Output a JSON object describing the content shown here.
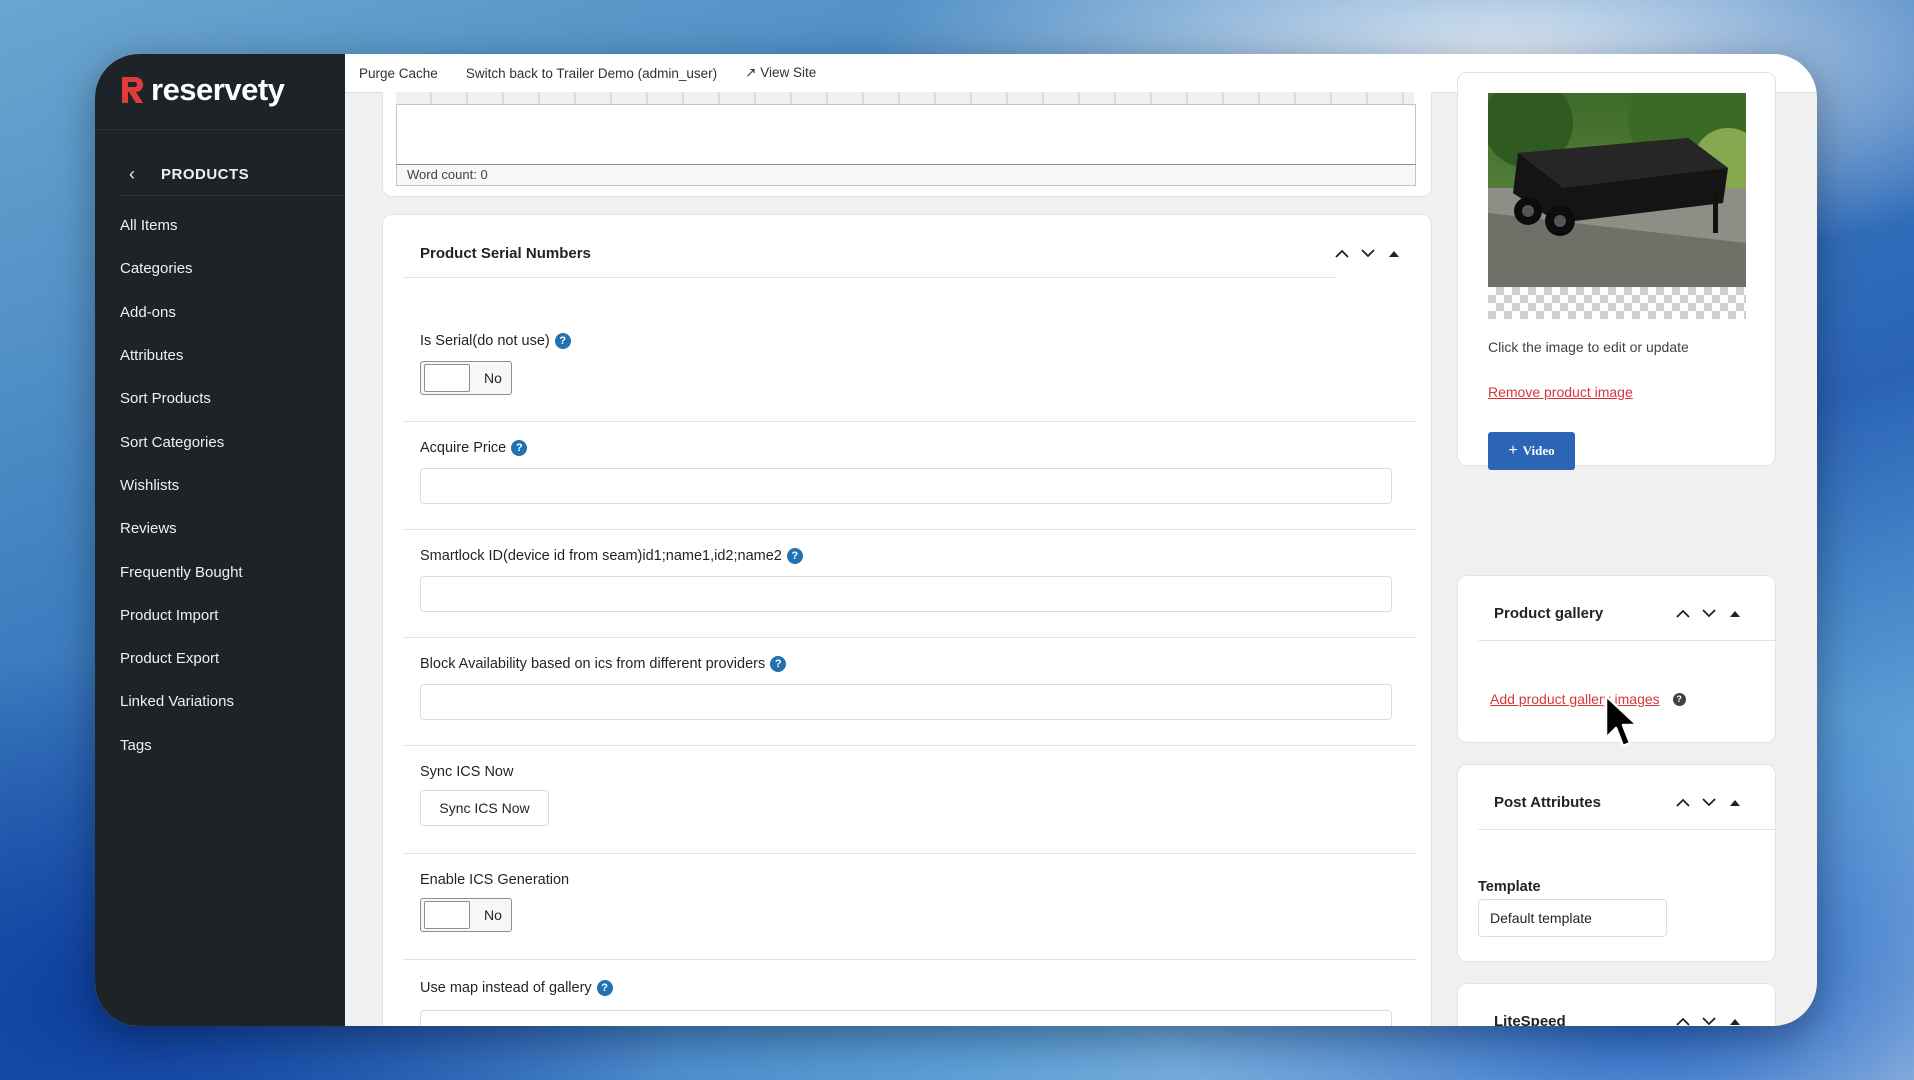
{
  "brand": {
    "name": "reservety",
    "accent": "#e03a3a"
  },
  "sidebar": {
    "section_title": "PRODUCTS",
    "items": [
      {
        "label": "All Items"
      },
      {
        "label": "Categories"
      },
      {
        "label": "Add-ons"
      },
      {
        "label": "Attributes"
      },
      {
        "label": "Sort Products"
      },
      {
        "label": "Sort Categories"
      },
      {
        "label": "Wishlists"
      },
      {
        "label": "Reviews"
      },
      {
        "label": "Frequently Bought"
      },
      {
        "label": "Product Import"
      },
      {
        "label": "Product Export"
      },
      {
        "label": "Linked Variations"
      },
      {
        "label": "Tags"
      }
    ]
  },
  "topbar": {
    "purge_cache": "Purge Cache",
    "switch_back": "Switch back to Trailer Demo (admin_user)",
    "view_site": "↗ View Site"
  },
  "editor": {
    "word_count": "Word count: 0"
  },
  "serial_panel": {
    "title": "Product Serial Numbers",
    "fields": {
      "is_serial": {
        "label": "Is Serial(do not use)",
        "value": "No"
      },
      "acquire_price": {
        "label": "Acquire Price",
        "value": ""
      },
      "smartlock": {
        "label": "Smartlock ID(device id from seam)id1;name1,id2;name2",
        "value": ""
      },
      "block_availability": {
        "label": "Block Availability based on ics from different providers",
        "value": ""
      },
      "sync_ics": {
        "label": "Sync ICS Now",
        "button": "Sync ICS Now"
      },
      "enable_ics": {
        "label": "Enable ICS Generation",
        "value": "No"
      },
      "use_map": {
        "label": "Use map instead of gallery"
      }
    }
  },
  "product_image": {
    "hint": "Click the image to edit or update",
    "remove_link": "Remove product image",
    "video_button": "Video"
  },
  "product_gallery": {
    "title": "Product gallery",
    "add_link": "Add product gallery images"
  },
  "post_attributes": {
    "title": "Post Attributes",
    "template_label": "Template",
    "template_value": "Default template"
  },
  "litespeed": {
    "title": "LiteSpeed"
  },
  "icons": [
    "chevron-left-icon",
    "help-icon",
    "chevron-up-icon",
    "chevron-down-icon",
    "collapse-triangle-icon",
    "plus-icon",
    "external-link-icon",
    "mouse-cursor-icon"
  ],
  "colors": {
    "sidebar_bg": "#1d2327",
    "link_red": "#d63638",
    "primary_blue": "#2c64b6",
    "help_blue": "#2271b1"
  }
}
